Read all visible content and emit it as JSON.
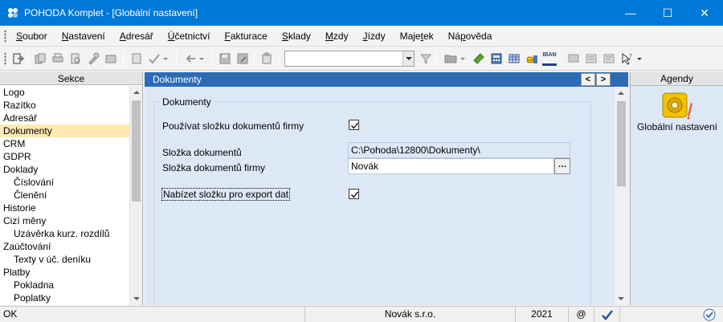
{
  "window": {
    "title": "POHODA Komplet - [Globální nastavení]",
    "minimize_glyph": "—",
    "maximize_glyph": "☐",
    "close_glyph": "✕"
  },
  "menu": [
    {
      "label": "Soubor",
      "key": "S",
      "rest": "oubor"
    },
    {
      "label": "Nastavení",
      "key": "N",
      "rest": "astavení"
    },
    {
      "label": "Adresář",
      "key": "A",
      "rest": "dresář"
    },
    {
      "label": "Účetnictví",
      "key": "Ú",
      "rest": "četnictví"
    },
    {
      "label": "Fakturace",
      "key": "F",
      "rest": "akturace"
    },
    {
      "label": "Sklady",
      "key": "S",
      "rest": "klady"
    },
    {
      "label": "Mzdy",
      "key": "M",
      "rest": "zdy"
    },
    {
      "label": "Jízdy",
      "key": "J",
      "rest": "ízdy"
    },
    {
      "label": "Majetek",
      "pre": "Maje",
      "key": "t",
      "rest": "ek"
    },
    {
      "label": "Nápověda",
      "pre": "Ná",
      "key": "p",
      "rest": "ověda"
    }
  ],
  "toolbar": {
    "combo_value": "",
    "iban_label": "IBAN"
  },
  "sekce": {
    "header": "Sekce",
    "items": [
      {
        "label": "Logo",
        "level": 0
      },
      {
        "label": "Razítko",
        "level": 0
      },
      {
        "label": "Adresář",
        "level": 0
      },
      {
        "label": "Dokumenty",
        "level": 0,
        "selected": true
      },
      {
        "label": "CRM",
        "level": 0
      },
      {
        "label": "GDPR",
        "level": 0
      },
      {
        "label": "Doklady",
        "level": 0
      },
      {
        "label": "Číslování",
        "level": 1
      },
      {
        "label": "Členění",
        "level": 1
      },
      {
        "label": "Historie",
        "level": 0
      },
      {
        "label": "Cizí měny",
        "level": 0
      },
      {
        "label": "Uzávěrka kurz. rozdílů",
        "level": 1
      },
      {
        "label": "Zaúčtování",
        "level": 0
      },
      {
        "label": "Texty v úč. deníku",
        "level": 1
      },
      {
        "label": "Platby",
        "level": 0
      },
      {
        "label": "Pokladna",
        "level": 1
      },
      {
        "label": "Poplatky",
        "level": 1
      }
    ]
  },
  "main": {
    "header": "Dokumenty",
    "nav_prev": "<",
    "nav_next": ">",
    "group_title": "Dokumenty",
    "use_company_folder_label": "Používat složku dokumentů firmy",
    "use_company_folder_checked": true,
    "documents_folder_label": "Složka dokumentů",
    "documents_folder_value": "C:\\Pohoda\\12800\\Dokumenty\\",
    "company_folder_label": "Složka dokumentů firmy",
    "company_folder_value": "Novák",
    "browse_button": "…",
    "export_folder_label": "Nabízet složku pro export dat",
    "export_folder_checked": true
  },
  "agendy": {
    "header": "Agendy",
    "item_label": "Globální nastavení"
  },
  "status": {
    "left": "OK",
    "company": "Novák s.r.o.",
    "year": "2021",
    "at": "@"
  },
  "colors": {
    "titlebar": "#0078d7",
    "main_header": "#2d6bb5",
    "content_bg": "#dde8f6",
    "selected_bg": "#ffe9b3"
  }
}
